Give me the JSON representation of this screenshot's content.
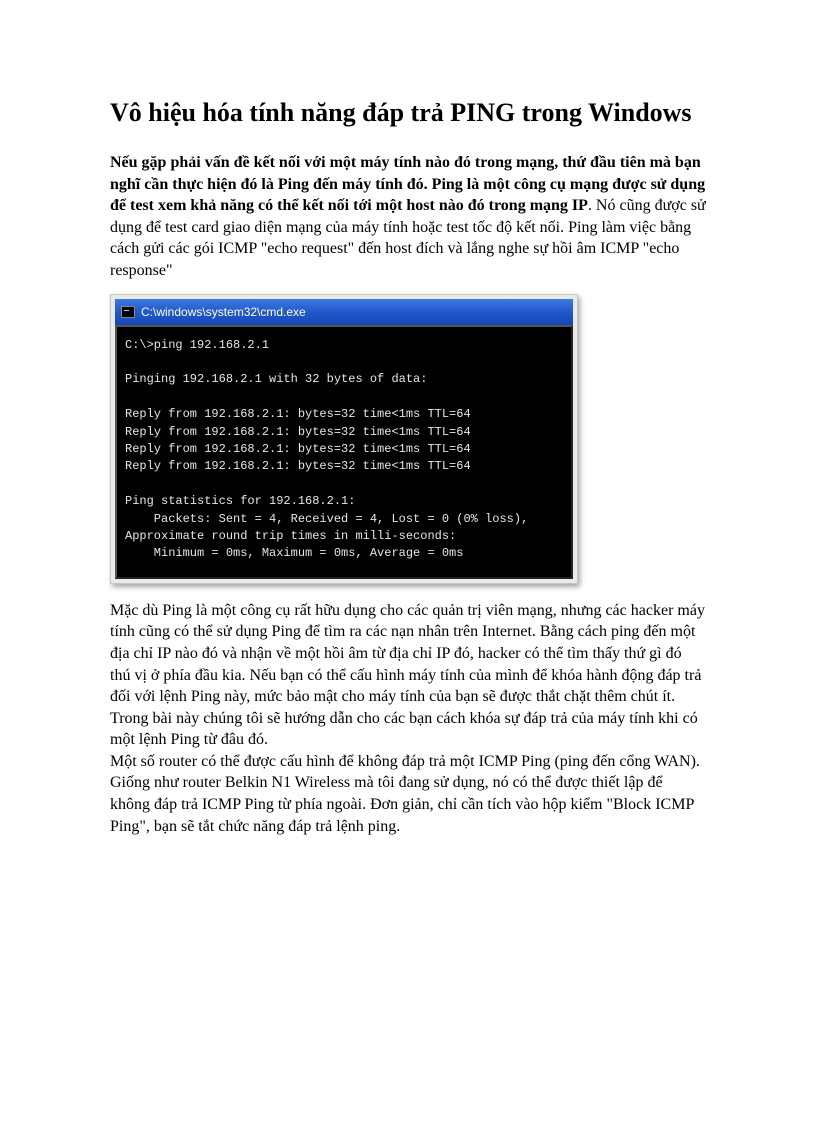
{
  "title": "Vô hiệu hóa tính năng đáp trả PING trong Windows",
  "intro_bold": "Nếu gặp phải vấn đề kết nối với một máy tính nào đó trong mạng, thứ đầu tiên mà bạn nghĩ cần thực hiện đó là Ping đến máy tính đó. Ping là một công cụ mạng được sử dụng để test xem khả năng có thể kết nối tới một host nào đó trong mạng IP",
  "intro_rest": ". Nó cũng được sử dụng để test card giao diện mạng của máy tính hoặc test tốc độ kết nối. Ping làm việc bằng cách gửi các gói ICMP \"echo request\" đến host đích và lắng nghe sự hồi âm ICMP \"echo response\"",
  "cmd": {
    "title": "C:\\windows\\system32\\cmd.exe",
    "lines": "C:\\>ping 192.168.2.1\n\nPinging 192.168.2.1 with 32 bytes of data:\n\nReply from 192.168.2.1: bytes=32 time<1ms TTL=64\nReply from 192.168.2.1: bytes=32 time<1ms TTL=64\nReply from 192.168.2.1: bytes=32 time<1ms TTL=64\nReply from 192.168.2.1: bytes=32 time<1ms TTL=64\n\nPing statistics for 192.168.2.1:\n    Packets: Sent = 4, Received = 4, Lost = 0 (0% loss),\nApproximate round trip times in milli-seconds:\n    Minimum = 0ms, Maximum = 0ms, Average = 0ms"
  },
  "para2": "Mặc dù Ping là một công cụ rất hữu dụng cho các quản trị viên mạng, nhưng các hacker máy tính cũng có thể sử dụng Ping để tìm ra các nạn nhân trên Internet. Bằng cách ping đến một địa chỉ IP nào đó và nhận về một hồi âm từ địa chỉ IP đó, hacker có thể tìm thấy thứ gì đó thú vị ở phía đầu kia. Nếu bạn có thể cấu hình máy tính của mình để khóa hành động đáp trả đối với lệnh Ping này, mức bảo mật cho máy tính của bạn sẽ được thắt chặt thêm chút ít. Trong bài này chúng tôi sẽ hướng dẫn cho các bạn cách khóa sự đáp trả của máy tính khi có một lệnh Ping từ đâu đó.",
  "para3": "Một số router có thể được cấu hình để không đáp trả một ICMP Ping (ping đến cổng WAN). Giống như router Belkin N1 Wireless mà tôi đang sử dụng, nó có thể được thiết lập để không đáp trả ICMP Ping từ phía ngoài. Đơn giản, chỉ cần tích vào hộp kiểm \"Block ICMP Ping\", bạn sẽ tắt chức năng đáp trả lệnh ping."
}
